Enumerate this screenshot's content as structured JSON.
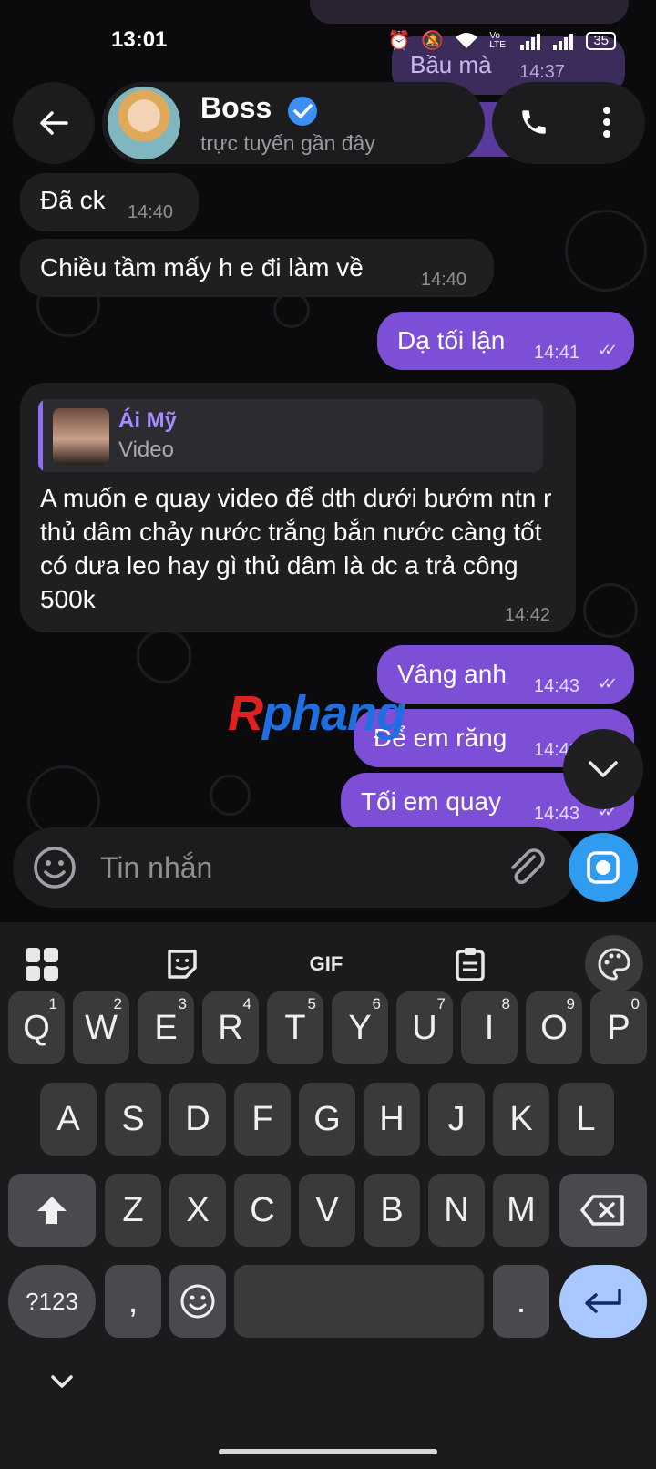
{
  "status_bar": {
    "time": "13:01",
    "network": "Vo LTE",
    "battery": "35"
  },
  "header": {
    "name": "Boss",
    "status": "trực tuyến gần đây"
  },
  "previous": {
    "text": "Bầu mà",
    "time": "14:37"
  },
  "messages": [
    {
      "text": "Đã ck",
      "time": "14:40"
    },
    {
      "text": "Chiều tầm mấy h e đi làm về",
      "time": "14:40"
    },
    {
      "text": "Dạ tối lận",
      "time": "14:41"
    },
    {
      "reply_name": "Ái Mỹ",
      "reply_type": "Video",
      "text": "A muốn e quay video để dth dưới bướm ntn r thủ dâm chảy nước trắng bắn nước càng tốt có dưa leo hay gì thủ dâm là dc a trả công 500k",
      "time": "14:42"
    },
    {
      "text": "Vâng anh",
      "time": "14:43"
    },
    {
      "text": "Để em răng",
      "time": "14:43"
    },
    {
      "text": "Tối em quay",
      "time": "14:43"
    }
  ],
  "watermark": {
    "r": "R",
    "rest": "phang"
  },
  "input": {
    "placeholder": "Tin nhắn"
  },
  "keyboard": {
    "toolbar": {
      "gif": "GIF"
    },
    "row1": [
      "Q",
      "W",
      "E",
      "R",
      "T",
      "Y",
      "U",
      "I",
      "O",
      "P"
    ],
    "row1_hints": [
      "1",
      "2",
      "3",
      "4",
      "5",
      "6",
      "7",
      "8",
      "9",
      "0"
    ],
    "row2": [
      "A",
      "S",
      "D",
      "F",
      "G",
      "H",
      "J",
      "K",
      "L"
    ],
    "row3": [
      "Z",
      "X",
      "C",
      "V",
      "B",
      "N",
      "M"
    ],
    "symbols": "?123",
    "comma": ",",
    "period": "."
  },
  "colors": {
    "outgoing_bubble": "#7c4fd6",
    "incoming_bubble": "#1f1f22",
    "accent_blue": "#2f9cf0",
    "enter_key": "#a8c8ff"
  }
}
